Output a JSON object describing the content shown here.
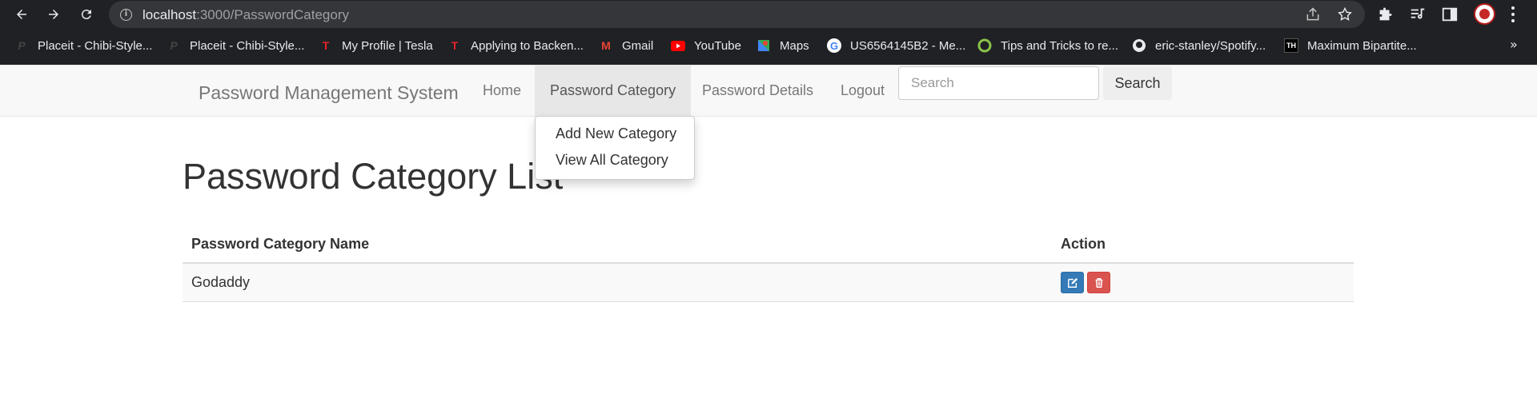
{
  "browser": {
    "url_host": "localhost",
    "url_path": ":3000/PasswordCategory",
    "bookmarks": [
      {
        "label": "Placeit - Chibi-Style...",
        "icon": "placeit-icon"
      },
      {
        "label": "Placeit - Chibi-Style...",
        "icon": "placeit-icon"
      },
      {
        "label": "My Profile | Tesla",
        "icon": "tesla-icon"
      },
      {
        "label": "Applying to Backen...",
        "icon": "tesla-icon"
      },
      {
        "label": "Gmail",
        "icon": "gmail-icon"
      },
      {
        "label": "YouTube",
        "icon": "youtube-icon"
      },
      {
        "label": "Maps",
        "icon": "maps-icon"
      },
      {
        "label": "US6564145B2 - Me...",
        "icon": "google-icon"
      },
      {
        "label": "Tips and Tricks to re...",
        "icon": "circle-icon"
      },
      {
        "label": "eric-stanley/Spotify...",
        "icon": "github-icon"
      },
      {
        "label": "Maximum Bipartite...",
        "icon": "th-icon"
      }
    ],
    "more_label": "»"
  },
  "navbar": {
    "brand": "Password Management System",
    "items": [
      {
        "label": "Home"
      },
      {
        "label": "Password Category"
      },
      {
        "label": "Password Details"
      },
      {
        "label": "Logout"
      }
    ],
    "search_placeholder": "Search",
    "search_button": "Search"
  },
  "dropdown": {
    "items": [
      {
        "label": "Add New Category"
      },
      {
        "label": "View All Category"
      }
    ]
  },
  "main": {
    "title": "Password Category List",
    "columns": [
      "Password Category Name",
      "Action"
    ],
    "rows": [
      {
        "name": "Godaddy"
      }
    ]
  },
  "colors": {
    "edit_button": "#337ab7",
    "delete_button": "#d9534f",
    "chrome_bg": "#202124"
  }
}
